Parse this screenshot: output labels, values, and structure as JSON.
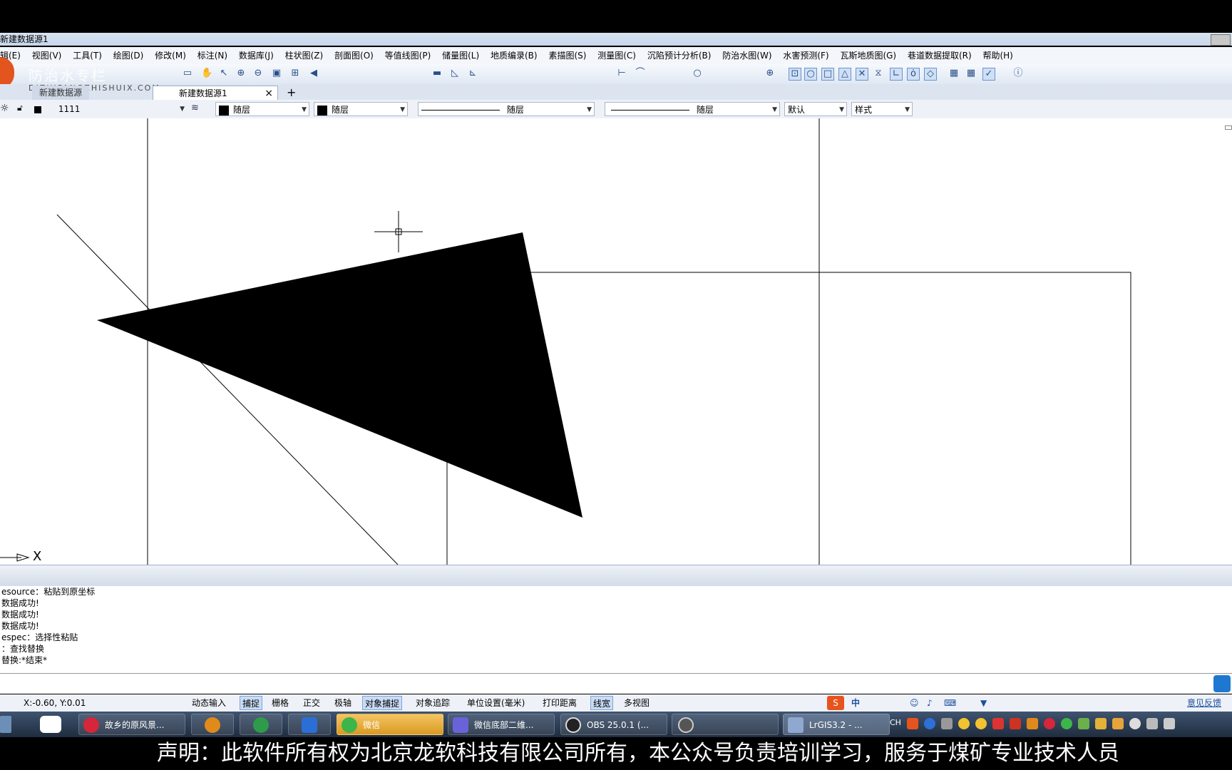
{
  "window": {
    "title": "新建数据源1"
  },
  "menu": [
    "辑(E)",
    "视图(V)",
    "工具(T)",
    "绘图(D)",
    "修改(M)",
    "标注(N)",
    "数据库(J)",
    "柱状图(Z)",
    "剖面图(O)",
    "等值线图(P)",
    "储量图(L)",
    "地质编录(B)",
    "素描图(S)",
    "测量图(C)",
    "沉陷预计分析(B)",
    "防治水图(W)",
    "水害预测(F)",
    "瓦斯地质图(G)",
    "巷道数据提取(R)",
    "帮助(H)"
  ],
  "watermark": {
    "line1": "防治水专栏",
    "line2": "DIZHIFANGZHISHUIX.COM"
  },
  "tabs": [
    {
      "label": "新建数据源"
    },
    {
      "label": "新建数据源1",
      "close": "×"
    },
    {
      "label": "+"
    }
  ],
  "properties": {
    "layer": "1111",
    "color1": "随层",
    "color2": "随层",
    "linetype1": "随层",
    "linetype2": "随层",
    "default": "默认",
    "style": "样式"
  },
  "canvas": {
    "axis_label": "X"
  },
  "command_log": [
    "esource：粘贴到原坐标",
    "数据成功!",
    "数据成功!",
    "数据成功!",
    "espec：选择性粘贴",
    "：查找替换",
    "替换:*结束*"
  ],
  "status": {
    "coords": "X:-0.60, Y:0.01",
    "toggles": [
      {
        "label": "动态输入",
        "on": false
      },
      {
        "label": "捕捉",
        "on": true
      },
      {
        "label": "栅格",
        "on": false
      },
      {
        "label": "正交",
        "on": false
      },
      {
        "label": "极轴",
        "on": false
      },
      {
        "label": "对象捕捉",
        "on": true
      },
      {
        "label": "对象追踪",
        "on": false
      },
      {
        "label": "单位设置(毫米)",
        "on": false
      },
      {
        "label": "打印距离",
        "on": false
      },
      {
        "label": "线宽",
        "on": true
      },
      {
        "label": "多视图",
        "on": false
      }
    ],
    "feedback": "意见反馈",
    "ime": "中"
  },
  "taskbar": {
    "tasks": [
      {
        "label": "故乡的原风景...",
        "color": "#d6263a"
      },
      {
        "label": "",
        "color": "#e08a1c"
      },
      {
        "label": "",
        "color": "#2e9b4a"
      },
      {
        "label": "",
        "color": "#2b6fd6"
      },
      {
        "label": "微信",
        "color": "#3db54a"
      },
      {
        "label": "微信底部二维...",
        "color": "#6a62d8"
      },
      {
        "label": "OBS 25.0.1 (...",
        "color": "#222222"
      },
      {
        "label": "",
        "color": "#555555"
      },
      {
        "label": "LrGIS3.2 - ...",
        "color": "#8ea8d0"
      }
    ],
    "tray_lang": "CH"
  },
  "notice": "声明：此软件所有权为北京龙软科技有限公司所有，本公众号负责培训学习，服务于煤矿专业技术人员"
}
